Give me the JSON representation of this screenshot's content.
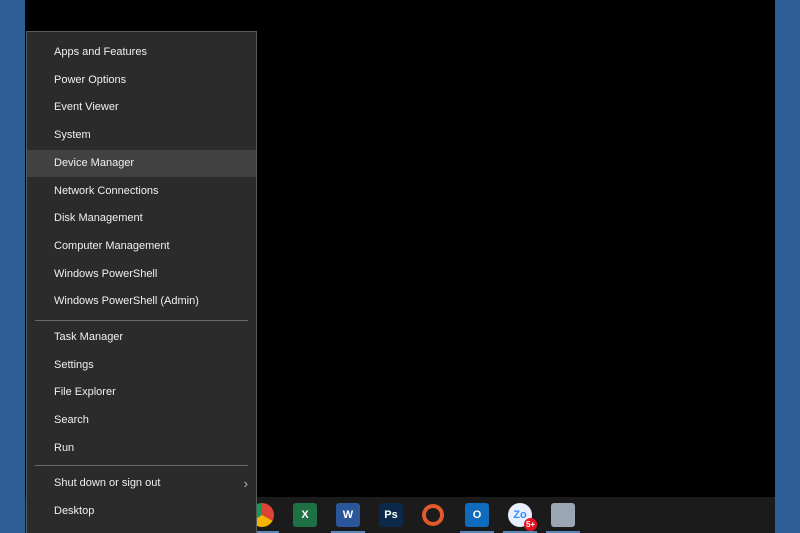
{
  "menu": {
    "group1": [
      {
        "label": "Apps and Features",
        "accel": 9
      },
      {
        "label": "Power Options",
        "accel": 6
      },
      {
        "label": "Event Viewer",
        "accel": 6
      },
      {
        "label": "System",
        "accel": 1
      },
      {
        "label": "Device Manager",
        "accel": 7,
        "hover": true
      },
      {
        "label": "Network Connections",
        "accel": 3
      },
      {
        "label": "Disk Management",
        "accel": 3
      },
      {
        "label": "Computer Management",
        "accel": 13
      },
      {
        "label": "Windows PowerShell",
        "accel": 1
      },
      {
        "label": "Windows PowerShell (Admin)",
        "accel": 20
      }
    ],
    "group2": [
      {
        "label": "Task Manager",
        "accel": 0
      },
      {
        "label": "Settings",
        "accel": 5
      },
      {
        "label": "File Explorer",
        "accel": 5
      },
      {
        "label": "Search",
        "accel": 0
      },
      {
        "label": "Run",
        "accel": 0
      }
    ],
    "group3": [
      {
        "label": "Shut down or sign out",
        "accel": 2,
        "submenu": true
      },
      {
        "label": "Desktop",
        "accel": 0
      }
    ],
    "chevron": "›"
  },
  "taskbar": {
    "icons": [
      {
        "name": "chrome",
        "text": "",
        "color": "#d9a43a",
        "active": true
      },
      {
        "name": "excel",
        "text": "X",
        "color": "#1e7145",
        "active": false
      },
      {
        "name": "word",
        "text": "W",
        "color": "#2b579a",
        "active": true
      },
      {
        "name": "photoshop",
        "text": "Ps",
        "color": "#0b2a4a",
        "active": false
      },
      {
        "name": "app-ring",
        "text": "",
        "color": "#1b1b1b",
        "active": false
      },
      {
        "name": "outlook",
        "text": "O",
        "color": "#0f6cbd",
        "active": true
      },
      {
        "name": "zoom",
        "text": "Zo",
        "color": "#e8f0ff",
        "active": true,
        "badge": "5+"
      },
      {
        "name": "monitor",
        "text": "",
        "color": "#9aa6b4",
        "active": true
      }
    ]
  }
}
